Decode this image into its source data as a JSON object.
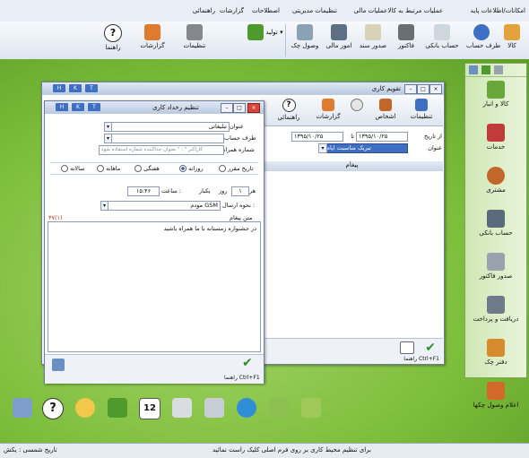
{
  "menu": [
    "امکانات/اطلاعات پایه",
    "عملیات مرتبط به کالا",
    "عملیات مالی",
    "تنظیمات مدیریتی",
    "اصطلاحات",
    "گزارشات",
    "راهنمائی"
  ],
  "ribbon": [
    {
      "label": "کالا",
      "icon": "pencil-icon",
      "color": "#e3a23b"
    },
    {
      "label": "طرف حساب",
      "icon": "person-icon",
      "color": "#3f6fc5"
    },
    {
      "label": "حساب بانکی",
      "icon": "card-icon",
      "color": "#cfd6de"
    },
    {
      "label": "فاکتور",
      "icon": "invoice-icon",
      "color": "#6b6e74"
    },
    {
      "label": "صدور سند",
      "icon": "document-icon",
      "color": "#d9d2b8"
    },
    {
      "label": "امور مالی",
      "icon": "money-icon",
      "color": "#5c6f85"
    },
    {
      "label": "وصول چک",
      "icon": "check-icon",
      "color": "#8aa1b6"
    },
    {
      "label": "تولید",
      "icon": "box-icon",
      "color": "#4e9a2c"
    },
    {
      "label": "تنظیمات",
      "icon": "tools-icon",
      "color": "#85878b"
    },
    {
      "label": "گزارشات",
      "icon": "report-icon",
      "color": "#e07a2e"
    },
    {
      "label": "راهنما",
      "icon": "help-icon",
      "color": "#ffffff"
    }
  ],
  "sidebar": [
    {
      "label": "کالا و انبار",
      "icon": "box-icon",
      "color": "#6aa73a"
    },
    {
      "label": "خدمات",
      "icon": "service-icon",
      "color": "#c23b3b"
    },
    {
      "label": "مشتری",
      "icon": "customer-icon",
      "color": "#c2662a"
    },
    {
      "label": "حساب بانکی",
      "icon": "bank-icon",
      "color": "#5a6b7c"
    },
    {
      "label": "صدور فاکتور",
      "icon": "invoice-icon",
      "color": "#9aa3ad"
    },
    {
      "label": "دریافت و پرداخت",
      "icon": "payment-icon",
      "color": "#6d7b8a"
    },
    {
      "label": "دفتر چک",
      "icon": "chequebook-icon",
      "color": "#d88a2e"
    },
    {
      "label": "اعلام وصول چکها",
      "icon": "notify-icon",
      "color": "#d2692a"
    }
  ],
  "back_window": {
    "title": "تقویم کاری",
    "toolbar": [
      "تنظیمات",
      "اشخاص",
      "گزارشات",
      "راهنمائی"
    ],
    "from_label": "از تاریخ",
    "date_from": "۱۳۹۵/۱۰/۲۵",
    "to_label": "تا",
    "date_to": "۱۳۹۵/۱۰/۲۵",
    "title_label": "عنوان",
    "title_value": "تبریک مناسبت ایام",
    "column_header": "پیغام",
    "shortcut": "راهنما Ctrl+F1"
  },
  "dialog": {
    "title": "تنظیم رخداد کاری",
    "subject_label": "عنوان",
    "subject_value": "تبلیغاتی",
    "party_label": "طرف حساب",
    "party_value": "",
    "phone_label": "شماره همراه",
    "phone_placeholder": "کاراکتر \" ; \" بعنوان جداکننده شماره استفاده شود",
    "radios": [
      {
        "label": "تاریخ مقرر",
        "on": false
      },
      {
        "label": "روزانه",
        "on": true
      },
      {
        "label": "هفتگی",
        "on": false
      },
      {
        "label": "ماهانه",
        "on": false
      },
      {
        "label": "سالانه",
        "on": false
      }
    ],
    "every_label": "هر",
    "every_value": "۱",
    "day_label": "روز",
    "once_label": "یکبار",
    "hour_label": "ساعت :",
    "hour_value": "۱۵:۴۶",
    "send_label": "نحوه ارسال :",
    "send_value": "مودم GSM",
    "message_label": "متن پیغام",
    "counter": "۳۷(۱)",
    "message_text": "در جشنواره زمستانه با ما همراه باشید",
    "shortcut": "راهنما Ctrl+F1",
    "hkt": [
      "H",
      "K",
      "T"
    ]
  },
  "status_right": "برای تنظیم محیط کاری بر روی فرم اصلی کلیک راست نمائید",
  "status_left": "تاریخ شمسی : یکش",
  "colors": {
    "accent": "#3e6fc2",
    "desktop": "#7cbd3b",
    "counter": "#c0392b"
  }
}
